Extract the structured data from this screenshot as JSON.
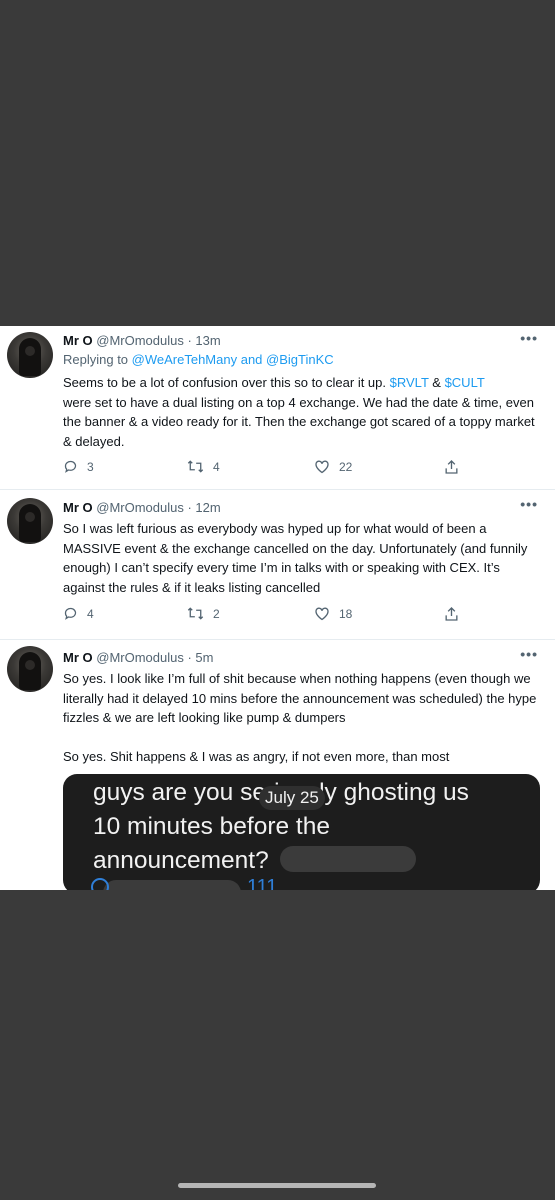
{
  "tweets": [
    {
      "name": "Mr O",
      "handle": "@MrOmodulus",
      "time": "· 13m",
      "reply_prefix": "Replying to ",
      "reply_users": "@WeAreTehMany and @BigTinKC",
      "text_a": "Seems to be a lot of confusion over this so to clear it up. ",
      "cashtag1": "$RVLT",
      "amp": " & ",
      "cashtag2": "$CULT",
      "text_b": "were set to have a dual listing on a top 4 exchange. We had the date & time, even the banner & a video ready for it. Then the exchange got scared of a toppy market & delayed.",
      "replies": "3",
      "retweets": "4",
      "likes": "22"
    },
    {
      "name": "Mr O",
      "handle": "@MrOmodulus",
      "time": "· 12m",
      "text": "So I was left furious as everybody was hyped up for what would of been a MASSIVE event & the exchange cancelled on the day. Unfortunately (and funnily enough) I can’t specify every time I’m in talks with or speaking with CEX. It’s against the rules & if it leaks listing cancelled",
      "replies": "4",
      "retweets": "2",
      "likes": "18"
    },
    {
      "name": "Mr O",
      "handle": "@MrOmodulus",
      "time": "· 5m",
      "text": "So yes. I look like I’m full of shit because when nothing happens (even though we literally had it delayed 10 mins before the announcement was scheduled) the hype fizzles & we are left looking like pump & dumpers\n\nSo yes. Shit happens & I was as angry, if not even more, than most",
      "media_text": "guys are you seriously ghosting us\n10 minutes before the\nannouncement?",
      "media_date": "July 25",
      "media_partial": "111"
    }
  ],
  "colors": {
    "link": "#1d9bf0",
    "text": "#0f1419",
    "muted": "#536471",
    "background_dark": "#3a3a3a"
  },
  "icons": [
    "avatar",
    "more-icon",
    "reply-icon",
    "retweet-icon",
    "like-icon",
    "share-icon"
  ]
}
